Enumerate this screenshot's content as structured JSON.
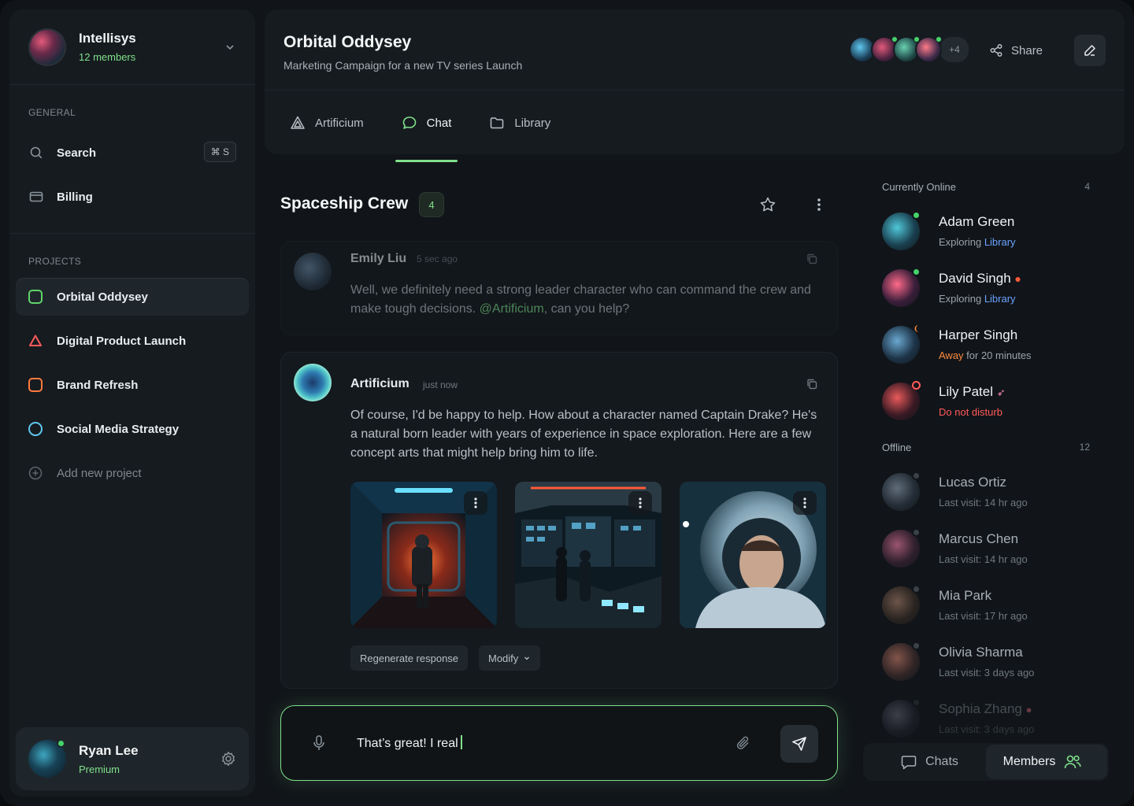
{
  "workspace": {
    "name": "Intellisys",
    "members": "12 members"
  },
  "nav": {
    "general_label": "GENERAL",
    "search_label": "Search",
    "search_shortcut": "⌘ S",
    "billing_label": "Billing",
    "projects_label": "PROJECTS",
    "projects": [
      {
        "label": "Orbital Oddysey",
        "color": "#5fd36a",
        "shape": "square"
      },
      {
        "label": "Digital Product Launch",
        "color": "#ff5a5a",
        "shape": "triangle"
      },
      {
        "label": "Brand Refresh",
        "color": "#ff7a3d",
        "shape": "square"
      },
      {
        "label": "Social Media Strategy",
        "color": "#5fc7ef",
        "shape": "circle"
      }
    ],
    "add_project": "Add new project"
  },
  "user": {
    "name": "Ryan Lee",
    "plan": "Premium"
  },
  "header": {
    "title": "Orbital Oddysey",
    "subtitle": "Marketing Campaign for a new TV series Launch",
    "more_avatars": "+4",
    "share_label": "Share",
    "tabs": [
      {
        "label": "Artificium"
      },
      {
        "label": "Chat"
      },
      {
        "label": "Library"
      }
    ]
  },
  "chat": {
    "title": "Spaceship Crew",
    "count": "4",
    "messages": [
      {
        "author": "Emily Liu",
        "time": "5 sec ago",
        "text_before": "Well, we definitely need a strong leader character who can command the crew and make tough decisions. ",
        "mention": "@Artificium",
        "text_after": ", can you help?"
      },
      {
        "author": "Artificium",
        "time": "just now",
        "text": "Of course, I'd be happy to help. How about a character named Captain Drake? He's a natural born leader with years of experience in space exploration. Here are a few concept arts that might help bring him to life."
      }
    ],
    "actions": {
      "regenerate": "Regenerate response",
      "modify": "Modify"
    },
    "composer_value": "That’s great! I real"
  },
  "members": {
    "online_label": "Currently Online",
    "online_count": "4",
    "offline_label": "Offline",
    "offline_count": "12",
    "online": [
      {
        "name": "Adam Green",
        "status_prefix": "Exploring ",
        "status_link": "Library",
        "dot": "#45d36a"
      },
      {
        "name": "David Singh",
        "status_prefix": "Exploring ",
        "status_link": "Library",
        "dot": "#45d36a"
      },
      {
        "name": "Harper Singh",
        "status_prefix": "Away",
        "status_suffix": " for 20 minutes",
        "dot": "#ff8a3d"
      },
      {
        "name": "Lily Patel",
        "status_prefix": "Do not disturb",
        "dot": "#ff5a5a"
      }
    ],
    "offline": [
      {
        "name": "Lucas Ortiz",
        "status": "Last visit: 14 hr ago"
      },
      {
        "name": "Marcus Chen",
        "status": "Last visit: 14 hr ago"
      },
      {
        "name": "Mia Park",
        "status": "Last visit: 17 hr ago"
      },
      {
        "name": "Olivia Sharma",
        "status": "Last visit: 3 days ago"
      },
      {
        "name": "Sophia Zhang",
        "status": "Last visit: 3 days ago"
      }
    ]
  },
  "bottom_tabs": {
    "chats": "Chats",
    "members": "Members"
  },
  "colors": {
    "accent": "#7fe08a",
    "link": "#6aa2ff",
    "away": "#ff8a3d",
    "dnd": "#ff5a5a"
  }
}
